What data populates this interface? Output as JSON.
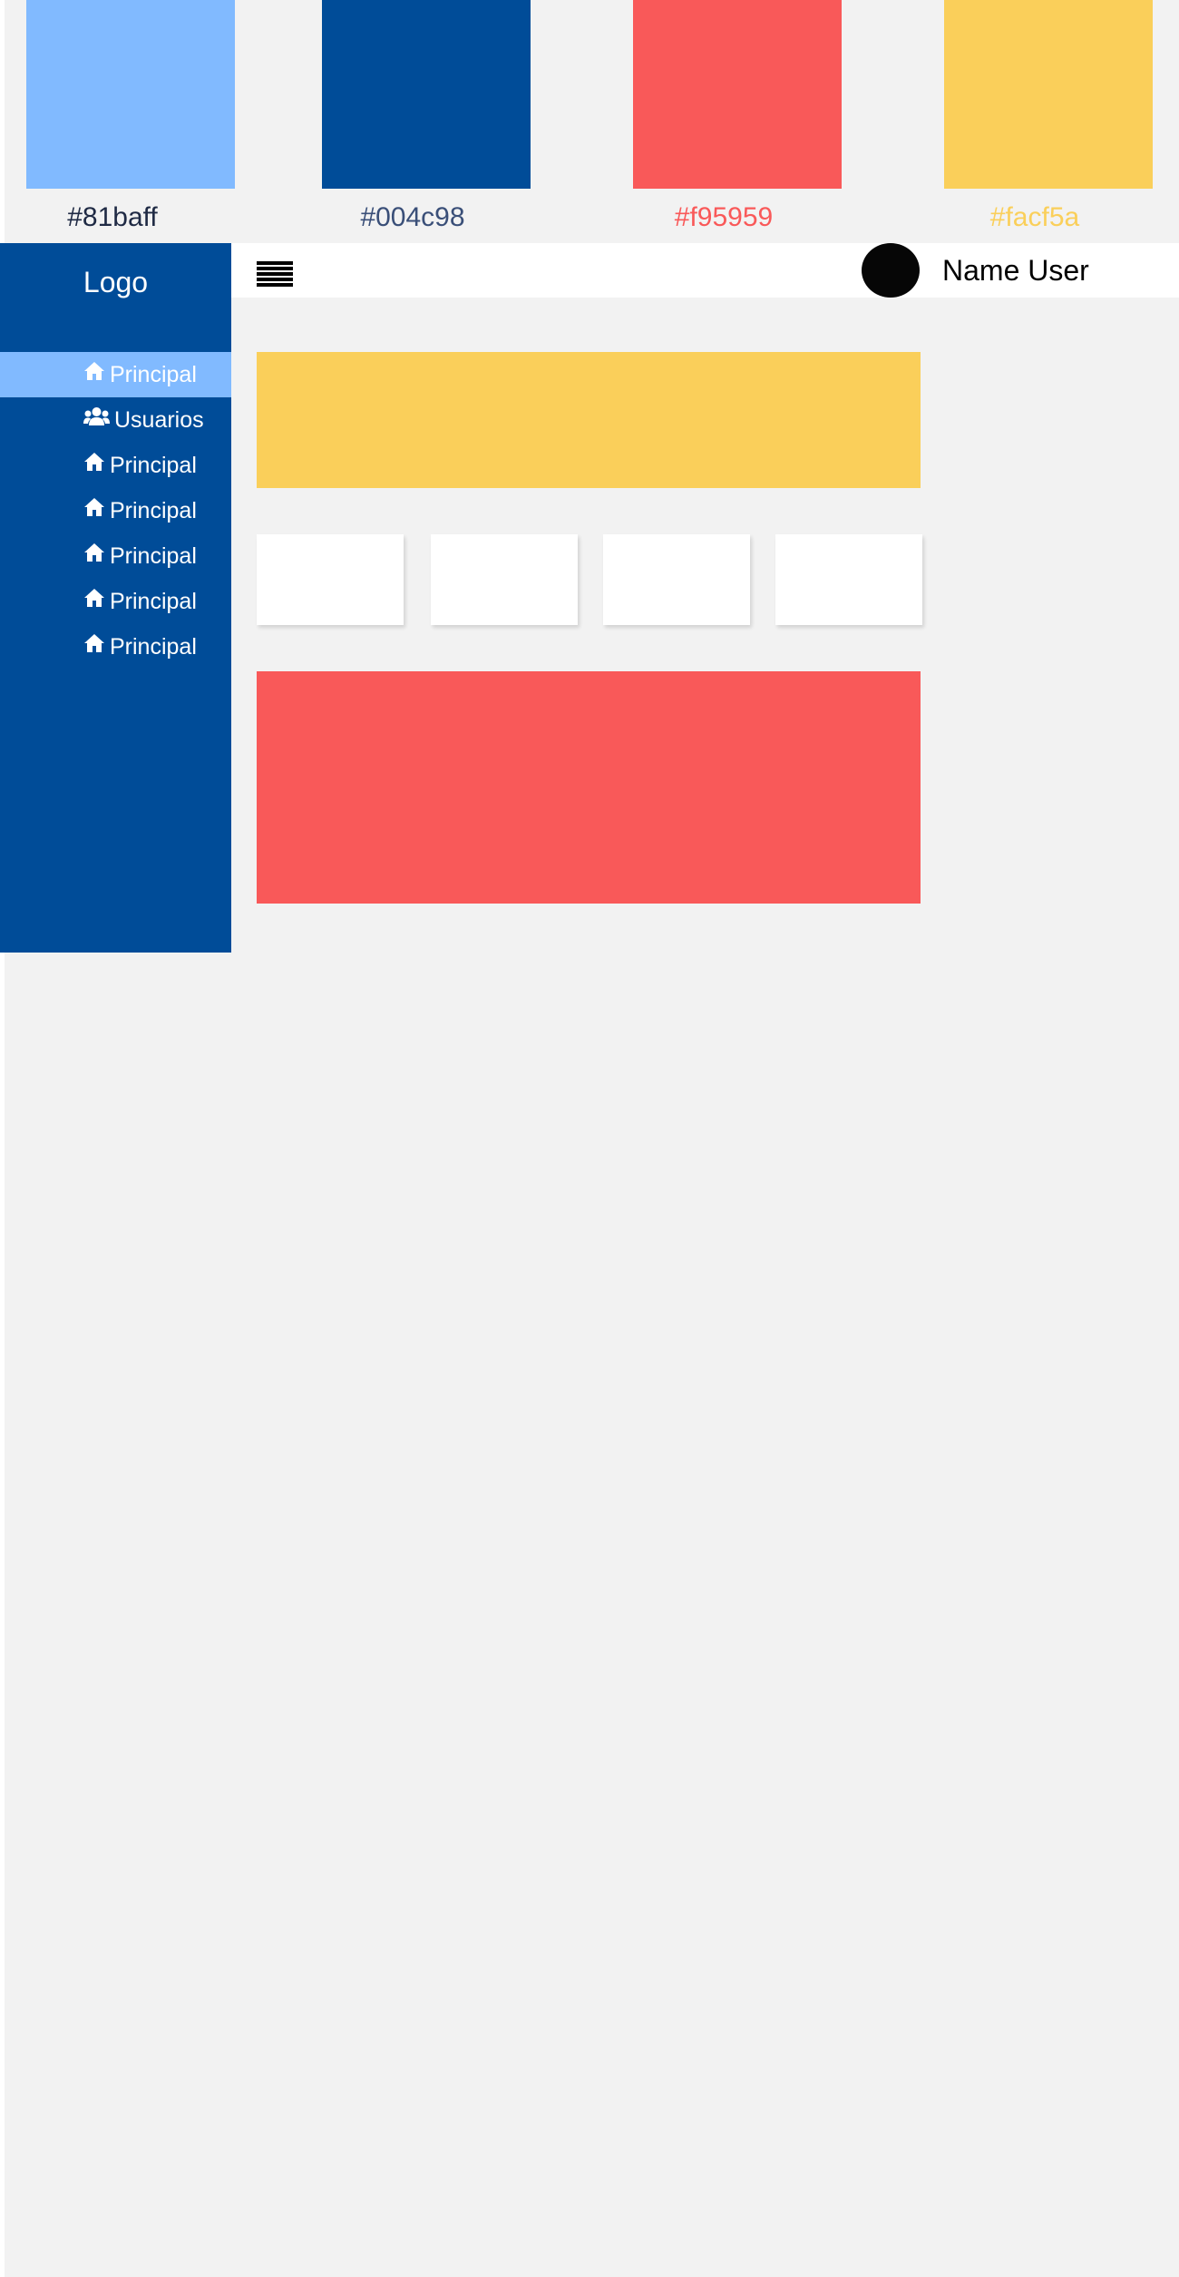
{
  "palette": [
    {
      "label": "#81baff",
      "color": "#81baff",
      "label_color": "#1f2a44"
    },
    {
      "label": "#004c98",
      "color": "#004c98",
      "label_color": "#3a4f78"
    },
    {
      "label": "#f95959",
      "color": "#f95959",
      "label_color": "#f95959"
    },
    {
      "label": "#facf5a",
      "color": "#facf5a",
      "label_color": "#facf5a"
    }
  ],
  "sidebar": {
    "logo": "Logo",
    "background": "#004c98",
    "active_color": "#81baff",
    "items": [
      {
        "label": "Principal",
        "icon": "home-icon",
        "active": true
      },
      {
        "label": "Usuarios",
        "icon": "users-icon",
        "active": false
      },
      {
        "label": "Principal",
        "icon": "home-icon",
        "active": false
      },
      {
        "label": "Principal",
        "icon": "home-icon",
        "active": false
      },
      {
        "label": "Principal",
        "icon": "home-icon",
        "active": false
      },
      {
        "label": "Principal",
        "icon": "home-icon",
        "active": false
      },
      {
        "label": "Principal",
        "icon": "home-icon",
        "active": false
      }
    ]
  },
  "topbar": {
    "menu_icon": "hamburger-menu-icon",
    "user_name": "Name User"
  },
  "content": {
    "top_banner_color": "#facf5a",
    "bottom_banner_color": "#f95959",
    "card_color": "#ffffff"
  }
}
